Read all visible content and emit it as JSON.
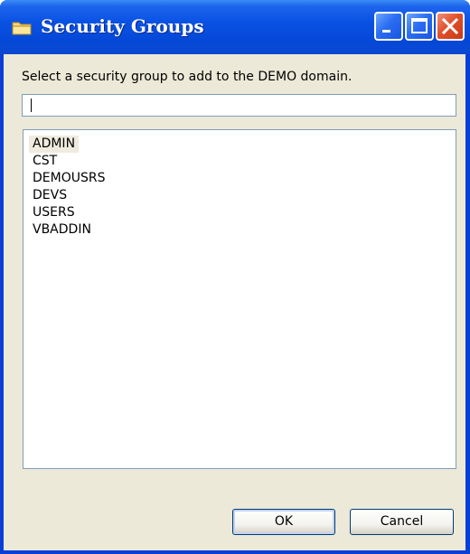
{
  "window": {
    "title": "Security Groups",
    "icon": "folder-icon"
  },
  "titlebar_buttons": {
    "minimize": "minimize-icon",
    "maximize": "maximize-icon",
    "close": "close-icon"
  },
  "prompt": "Select a security group to add to the DEMO domain.",
  "search": {
    "value": ""
  },
  "groups": [
    "ADMIN",
    "CST",
    "DEMOUSRS",
    "DEVS",
    "USERS",
    "VBADDIN"
  ],
  "selected_group": "ADMIN",
  "buttons": {
    "ok": "OK",
    "cancel": "Cancel"
  },
  "colors": {
    "titlebar": "#0548d8",
    "close_button": "#e0502c",
    "dialog_face": "#ece9d8",
    "selection": "#efebde"
  }
}
